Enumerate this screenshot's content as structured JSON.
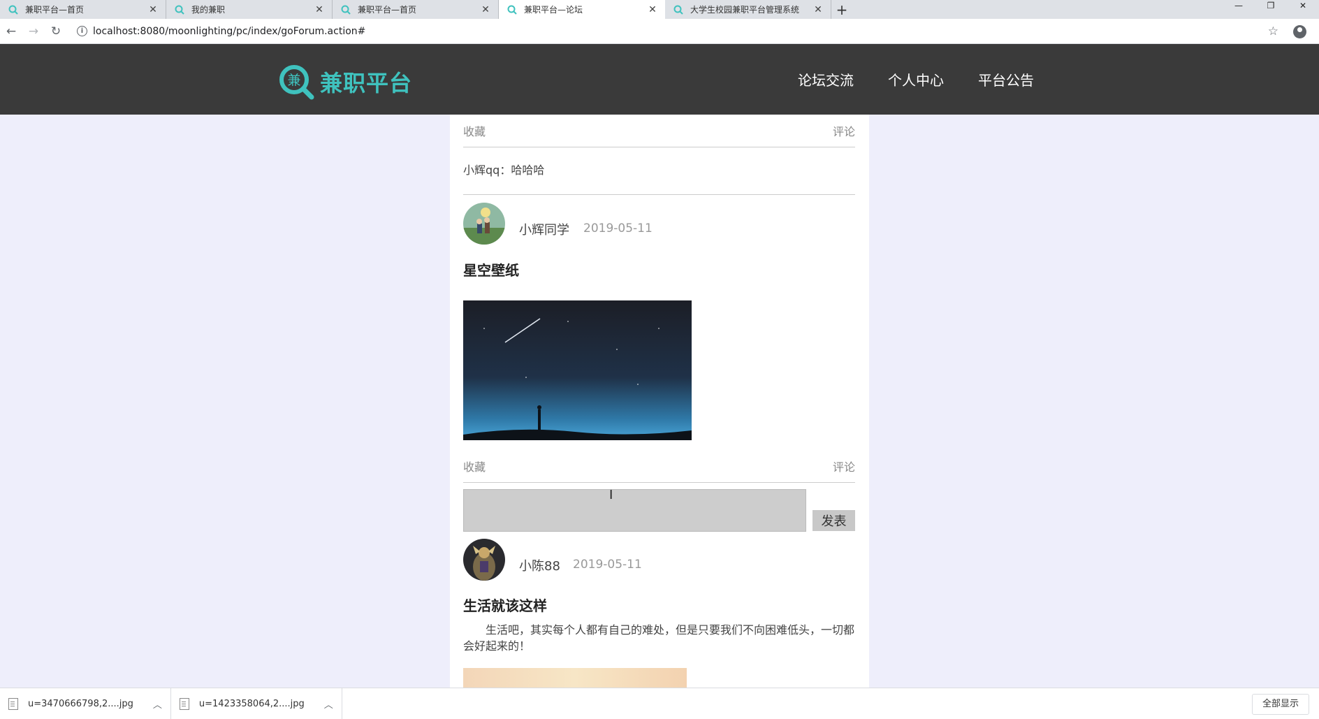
{
  "browser": {
    "tabs": [
      {
        "label": "兼职平台—首页",
        "active": false
      },
      {
        "label": "我的兼职",
        "active": false
      },
      {
        "label": "兼职平台—首页",
        "active": false
      },
      {
        "label": "兼职平台—论坛",
        "active": true
      },
      {
        "label": "大学生校园兼职平台管理系统",
        "active": false
      }
    ],
    "url": "localhost:8080/moonlighting/pc/index/goForum.action#"
  },
  "site": {
    "logo_char": "兼",
    "logo_text": "兼职平台",
    "nav": [
      "论坛交流",
      "个人中心",
      "平台公告"
    ]
  },
  "forum": {
    "prev_actions": {
      "favorite": "收藏",
      "comment": "评论"
    },
    "prev_comment": "小辉qq：哈哈哈",
    "post1": {
      "author": "小辉同学",
      "date": "2019-05-11",
      "title": "星空壁纸",
      "favorite": "收藏",
      "comment": "评论",
      "submit": "发表"
    },
    "post2": {
      "author": "小陈88",
      "date": "2019-05-11",
      "title": "生活就该这样",
      "body": "生活吧，其实每个人都有自己的难处，但是只要我们不向困难低头，一切都会好起来的！"
    }
  },
  "downloads": {
    "items": [
      "u=3470666798,2....jpg",
      "u=1423358064,2....jpg"
    ],
    "show_all": "全部显示"
  },
  "colors": {
    "accent": "#3fc2be",
    "header_bg": "#3a3a3a",
    "page_bg": "#eeeefb"
  }
}
